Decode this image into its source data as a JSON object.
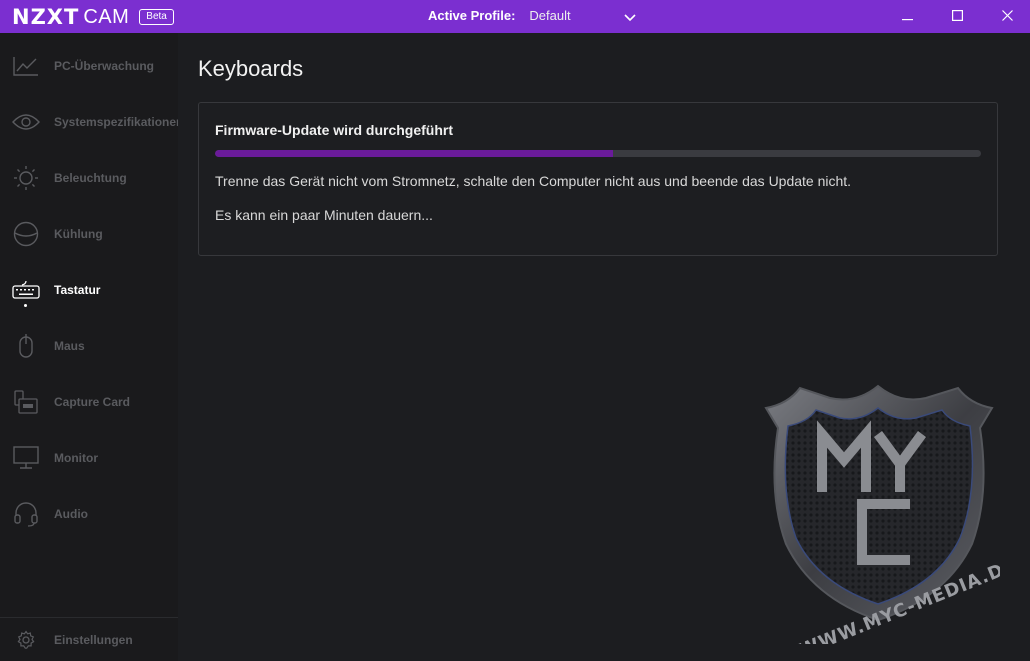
{
  "titlebar": {
    "logo_brand": "NZXT",
    "logo_product": "CAM",
    "beta_badge": "Beta",
    "profile_label": "Active Profile:",
    "profile_value": "Default",
    "window_controls": {
      "minimize": "minimize-icon",
      "maximize": "maximize-icon",
      "close": "close-icon"
    }
  },
  "sidebar": {
    "items": [
      {
        "label": "PC-Überwachung",
        "icon": "chart-line-icon"
      },
      {
        "label": "Systemspezifikationen",
        "icon": "eye-icon"
      },
      {
        "label": "Beleuchtung",
        "icon": "sun-icon"
      },
      {
        "label": "Kühlung",
        "icon": "fan-icon"
      },
      {
        "label": "Tastatur",
        "icon": "keyboard-icon",
        "active": true
      },
      {
        "label": "Maus",
        "icon": "mouse-icon"
      },
      {
        "label": "Capture Card",
        "icon": "capture-card-icon"
      },
      {
        "label": "Monitor",
        "icon": "monitor-icon"
      },
      {
        "label": "Audio",
        "icon": "headset-icon"
      }
    ],
    "settings_label": "Einstellungen"
  },
  "main": {
    "title": "Keyboards",
    "update_card": {
      "title": "Firmware-Update wird durchgeführt",
      "progress": 0.52,
      "message": "Trenne das Gerät nicht vom Stromnetz, schalte den Computer nicht aus und beende das Update nicht.",
      "note": "Es kann ein paar Minuten dauern..."
    }
  },
  "watermark": {
    "letters": "MYC",
    "url": "WWW.MYC-MEDIA.DE"
  },
  "colors": {
    "accent": "#7b2fd0",
    "progress_fill": "#6a1b9a",
    "background": "#1c1d20"
  }
}
